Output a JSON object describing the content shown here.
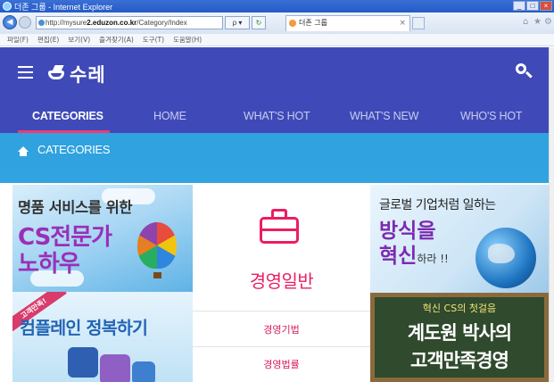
{
  "browser": {
    "window_title": "더존 그룹 - Internet Explorer",
    "window_buttons": [
      "_",
      "□",
      "×"
    ],
    "address_prefix": "http://mysure",
    "address_host": "2.eduzon.co.kr",
    "address_path": "/Category/Index",
    "search_dropdown": "ρ ▾",
    "refresh_symbol": "↻",
    "tab_title": "더존 그룹",
    "tab_close": "×",
    "menu": [
      "파일(F)",
      "편집(E)",
      "보기(V)",
      "즐겨찾기(A)",
      "도구(T)",
      "도움말(H)"
    ],
    "right_icons": [
      "⌂",
      "★",
      "⚙"
    ]
  },
  "header": {
    "logo_text": "수레",
    "search_icon": "search-icon",
    "menu_icon": "hamburger-icon"
  },
  "nav": {
    "items": [
      {
        "label": "CATEGORIES",
        "active": true
      },
      {
        "label": "HOME",
        "active": false
      },
      {
        "label": "WHAT'S HOT",
        "active": false
      },
      {
        "label": "WHAT'S NEW",
        "active": false
      },
      {
        "label": "WHO'S HOT",
        "active": false
      }
    ],
    "accent_color": "#f03a70"
  },
  "breadcrumb": {
    "icon": "home-icon",
    "label": "CATEGORIES"
  },
  "tiles": {
    "cs": {
      "line1": "명품 서비스를 위한",
      "line2": "CS전문가",
      "line3": "노하우"
    },
    "complain": {
      "ribbon": "고객만족!",
      "line1": "컴플레인 정복하기"
    },
    "global": {
      "line1": "글로벌 기업처럼 일하는",
      "line2": "방식을",
      "line3": "혁신",
      "line3_suffix": "하라 !!"
    },
    "chalk": {
      "line1": "혁신 CS의 첫걸음",
      "line2": "계도원 박사의",
      "line3": "고객만족경영"
    }
  },
  "category_card": {
    "icon": "briefcase-icon",
    "title": "경영일반",
    "subitems": [
      "경영기법",
      "경영법률"
    ],
    "color": "#e91e63"
  },
  "colors": {
    "header_bg": "#3f4ab8",
    "breadcrumb_bg": "#2fa2df"
  }
}
